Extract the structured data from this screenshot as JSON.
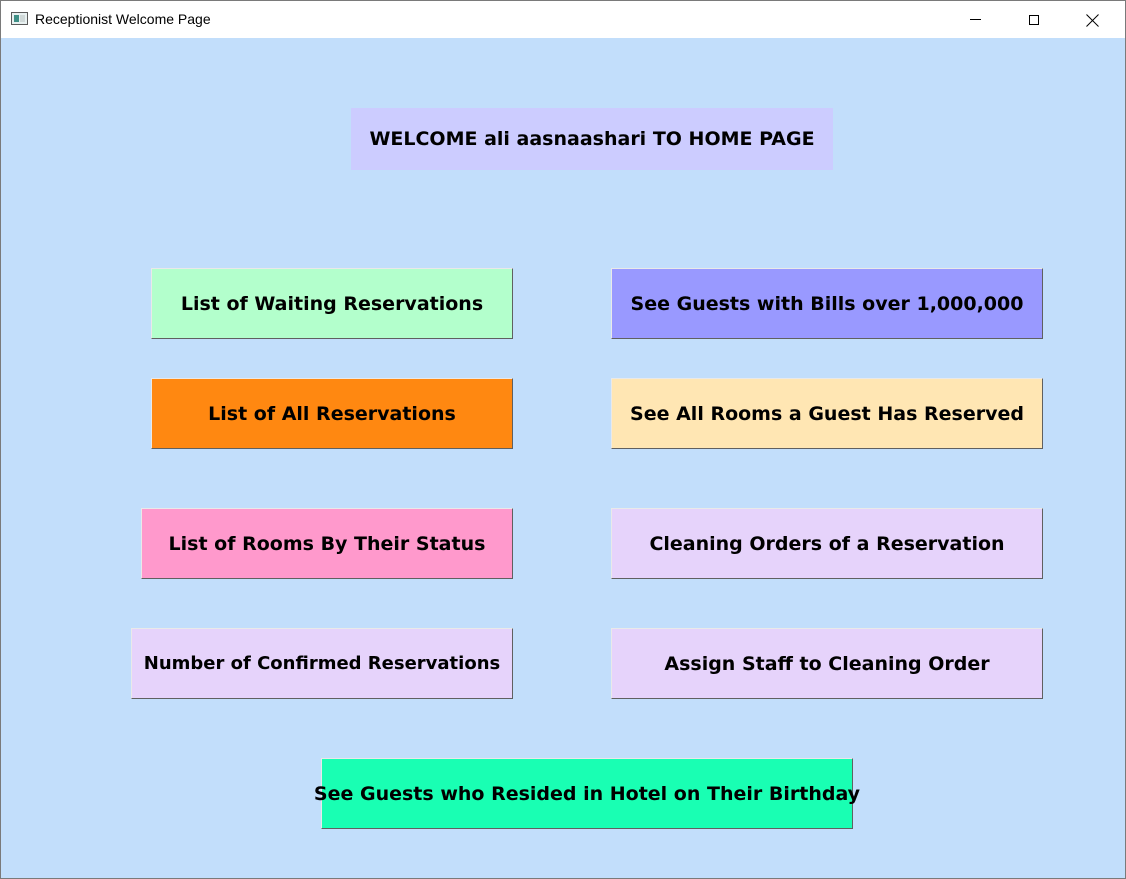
{
  "window": {
    "title": "Receptionist Welcome Page",
    "controls": {
      "minimize": "minimize-icon",
      "maximize": "maximize-icon",
      "close": "close-icon"
    }
  },
  "welcome": {
    "text": "WELCOME ali aasnaashari TO HOME PAGE",
    "background": "#ccccff"
  },
  "colors": {
    "client_background": "#c2defb"
  },
  "buttons": [
    {
      "label": "List of Waiting Reservations",
      "color": "#b3ffcc"
    },
    {
      "label": "See Guests with Bills over 1,000,000",
      "color": "#9999ff"
    },
    {
      "label": "List of All Reservations",
      "color": "#ff8811"
    },
    {
      "label": "See All Rooms a Guest Has Reserved",
      "color": "#ffe6b3"
    },
    {
      "label": "List of Rooms By Their Status",
      "color": "#ff99cc"
    },
    {
      "label": "Cleaning Orders of a Reservation",
      "color": "#e6d3fb"
    },
    {
      "label": "Number of Confirmed Reservations",
      "color": "#e6d3fb"
    },
    {
      "label": "Assign Staff to Cleaning Order",
      "color": "#e6d3fb"
    },
    {
      "label": "See Guests who Resided in Hotel on Their Birthday",
      "color": "#19ffb3"
    }
  ]
}
